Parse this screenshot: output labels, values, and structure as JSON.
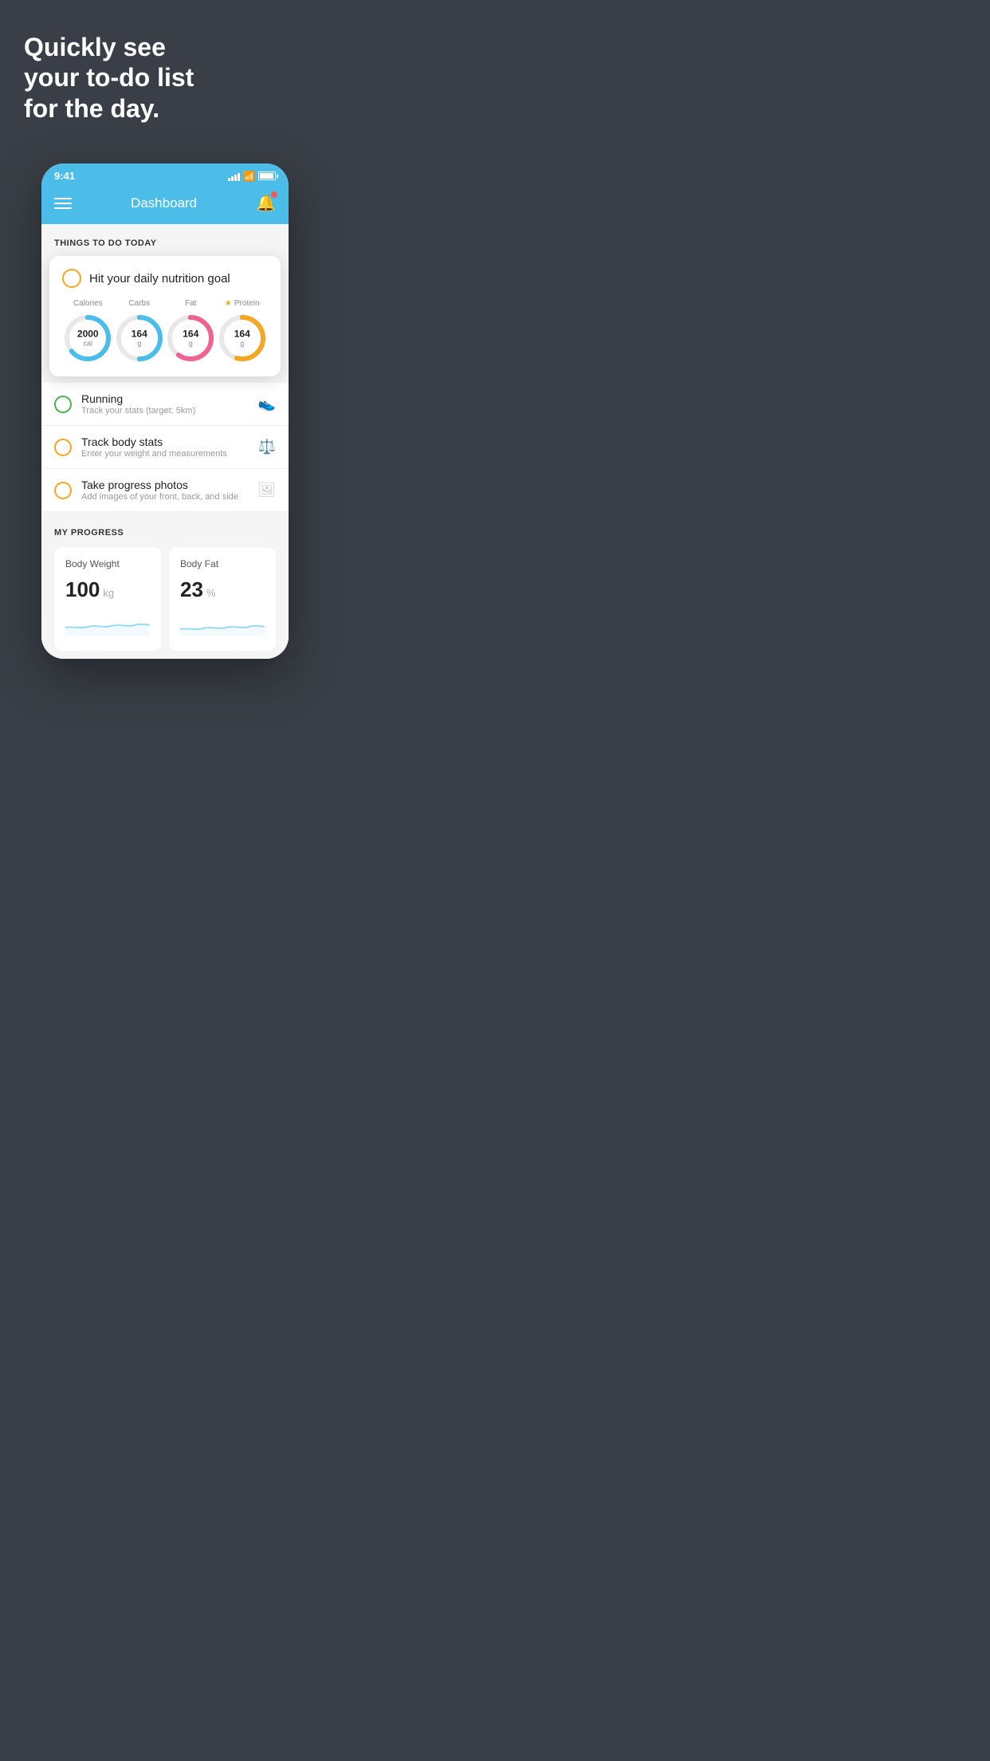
{
  "hero": {
    "title": "Quickly see\nyour to-do list\nfor the day."
  },
  "status_bar": {
    "time": "9:41"
  },
  "header": {
    "title": "Dashboard"
  },
  "things_today": {
    "section_label": "THINGS TO DO TODAY"
  },
  "nutrition_card": {
    "title": "Hit your daily nutrition goal",
    "items": [
      {
        "label": "Calories",
        "value": "2000",
        "unit": "cal",
        "color": "#4bbde8",
        "track_pct": 65
      },
      {
        "label": "Carbs",
        "value": "164",
        "unit": "g",
        "color": "#4bbde8",
        "track_pct": 50
      },
      {
        "label": "Fat",
        "value": "164",
        "unit": "g",
        "color": "#f06292",
        "track_pct": 60
      },
      {
        "label": "Protein",
        "value": "164",
        "unit": "g",
        "color": "#f5a623",
        "starred": true,
        "track_pct": 55
      }
    ]
  },
  "todo_items": [
    {
      "circle_color": "green",
      "title": "Running",
      "subtitle": "Track your stats (target: 5km)",
      "icon": "shoe"
    },
    {
      "circle_color": "yellow",
      "title": "Track body stats",
      "subtitle": "Enter your weight and measurements",
      "icon": "scale"
    },
    {
      "circle_color": "yellow",
      "title": "Take progress photos",
      "subtitle": "Add images of your front, back, and side",
      "icon": "photo"
    }
  ],
  "progress": {
    "section_label": "MY PROGRESS",
    "cards": [
      {
        "title": "Body Weight",
        "value": "100",
        "unit": "kg"
      },
      {
        "title": "Body Fat",
        "value": "23",
        "unit": "%"
      }
    ]
  }
}
